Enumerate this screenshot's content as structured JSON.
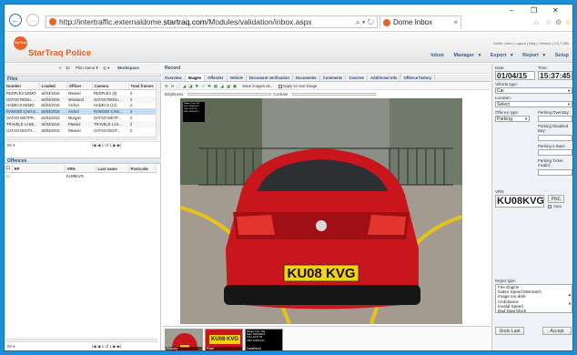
{
  "browser": {
    "url_prefix": "http://intertraffic.externaldome.",
    "url_domain": "startraq.com",
    "url_path": "/Modules/validation/inbox.aspx",
    "tab_title": "Dome Inbox",
    "minimize": "–",
    "maximize": "❐",
    "close": "✕",
    "search_dd": "⌕ ▾ ↻"
  },
  "app": {
    "logo_text": "StarTraq",
    "brand": "StarTraq Police",
    "user_line": "Smith John  |  Logout  |  Help  |  Version | V4.7.080",
    "menu": [
      "Inbox",
      "Manager ▾",
      "Export ▾",
      "Report ▾",
      "Setup"
    ]
  },
  "left": {
    "toolbar": [
      "3x",
      "Plim name ▾",
      "◎ ▾",
      "Workspace"
    ],
    "files_title": "Files",
    "files_cols": [
      "Number",
      "Loaded",
      "Officer",
      "Camera",
      "Total frames"
    ],
    "files_rows": [
      [
        "REDPLEX DEMO",
        "16/04/2015",
        "Weasel",
        "REDPLEX (9)",
        "2"
      ],
      [
        "GATSO REDLI...",
        "16/04/2015",
        "Wiseland",
        "GATSO REDLI...",
        "2"
      ],
      [
        "HADECS DEMO",
        "16/04/2015",
        "Archer",
        "HADECS (12)",
        "2"
      ],
      [
        "RANGER CAM D...",
        "16/04/2015",
        "Archer",
        "RANGER CAM ...",
        "2"
      ],
      [
        "GATSO WETPR...",
        "16/04/2015",
        "Morgan",
        "GATSO WETP...",
        "2"
      ],
      [
        "TRAVELD LASE...",
        "16/04/2015",
        "Panasz",
        "TRAVELD LAS...",
        "2"
      ],
      [
        "GATSO DIGITA...",
        "16/04/2015",
        "Weaver",
        "GATSO DIGIT...",
        "2"
      ]
    ],
    "files_pager": "|◀  ◀  1  of 1  ▶  ▶|",
    "files_pagesize": "50 ▾",
    "offences_title": "Offences",
    "off_cols": [
      "☐",
      "RP",
      "VRN",
      "Last name",
      "Postcode"
    ],
    "off_rows": [
      [
        "☐",
        "",
        "KU08KVG",
        "",
        ""
      ]
    ],
    "off_pager": "|◀  ◀  1  of 1  ▶  ▶|",
    "off_pagesize": "50 ▾"
  },
  "centre": {
    "record_title": "Record",
    "tabs": [
      "Overview",
      "Images",
      "Offender",
      "Vehicle",
      "Document verification",
      "Documents",
      "Comments",
      "Courses",
      "Additional info",
      "Offence history"
    ],
    "active_tab": "Images",
    "tool_icons": "⊕ ⊖ ⛶ ◢ ◪ ✖ ⊹ ✚ ▦ ◢ ◪ ▣",
    "save_label": "Save images as...",
    "apply_label": "Apply to next image",
    "brightness": "Brightness",
    "contrast": "Contrast",
    "overlay_text": "Ranger Cam: 001\nDate: 16/04/2015\nTime: 15:37:45\nVRN: KU08 KVG",
    "plate": "KU08 KVG",
    "thumbs": [
      "Primary",
      "Plate",
      "DataBlock"
    ],
    "thumb_plate": "KU08 KVG",
    "thumb_data": "Ranger Cam: 001\nDate: 16/04/2015\nTime: 15:37:45\nVRN: KU08 KVG"
  },
  "right": {
    "date_label": "Date:",
    "date": "01/04/15",
    "time_label": "Time:",
    "time": "15:37:45",
    "vehicle_type_label": "Vehicle type:",
    "vehicle_type": "Car",
    "location_label": "Location:",
    "location": "Select",
    "offence_type_label": "Offence type:",
    "offence_type": "Parking",
    "overstay_label": "Parking Overstay:",
    "disabled_label": "Parking Disabled Bay:",
    "bays_label": "Parking 2 Bays:",
    "ticket_label": "Parking Ticket Invalid:",
    "vrn_label": "VRN:",
    "vrn": "KU08KVG",
    "pnc_button": "PNC",
    "auto_label": "Auto",
    "reject_label": "Reject type:",
    "reject_options": [
      "Fire Engine",
      "Gatso Speed Mismatch",
      "Image too dark",
      "Ambulance",
      "Invalid Speed",
      "Bad Data block"
    ],
    "undo_button": "Undo Last",
    "accept_button": "Accept"
  }
}
